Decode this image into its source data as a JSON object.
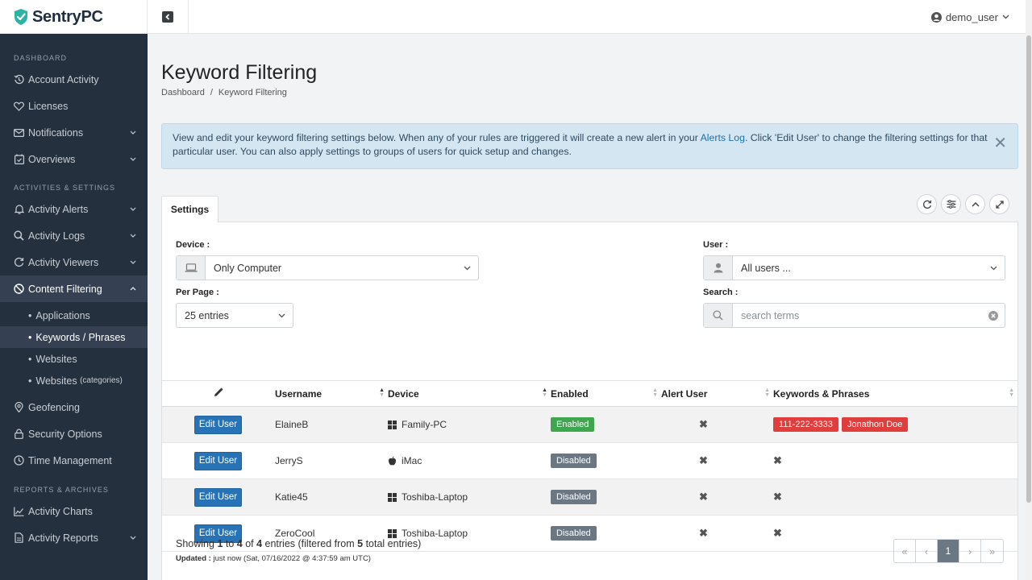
{
  "brand": {
    "name": "SentryPC"
  },
  "header": {
    "user": "demo_user"
  },
  "sidebar": {
    "sections": [
      {
        "title": "DASHBOARD",
        "items": [
          {
            "label": "Account Activity",
            "icon": "history-icon"
          },
          {
            "label": "Licenses",
            "icon": "heart-icon"
          },
          {
            "label": "Notifications",
            "icon": "envelope-icon"
          },
          {
            "label": "Overviews",
            "icon": "calendar-check-icon"
          }
        ]
      },
      {
        "title": "ACTIVITIES & SETTINGS",
        "items": [
          {
            "label": "Activity Alerts",
            "icon": "bell-icon"
          },
          {
            "label": "Activity Logs",
            "icon": "search-icon"
          },
          {
            "label": "Activity Viewers",
            "icon": "refresh-icon"
          },
          {
            "label": "Content Filtering",
            "icon": "ban-icon"
          },
          {
            "label": "Geofencing",
            "icon": "map-pin-icon"
          },
          {
            "label": "Security Options",
            "icon": "lock-icon"
          },
          {
            "label": "Time Management",
            "icon": "clock-icon"
          }
        ]
      },
      {
        "title": "REPORTS & ARCHIVES",
        "items": [
          {
            "label": "Activity Charts",
            "icon": "area-chart-icon"
          },
          {
            "label": "Activity Reports",
            "icon": "file-icon"
          }
        ]
      }
    ],
    "content_filtering_sub": [
      "Applications",
      "Keywords / Phrases",
      "Websites",
      "Websites",
      "(categories)"
    ]
  },
  "page": {
    "title": "Keyword Filtering",
    "breadcrumb": [
      "Dashboard",
      "/",
      "Keyword Filtering"
    ]
  },
  "alert": {
    "text_before": "View and edit your keyword filtering settings below.  When any of your rules are triggered it will create a new alert in your ",
    "link": "Alerts Log",
    "text_after": ".  Click 'Edit User' to change the filtering settings for that particular user.  You can also apply settings to groups of users for quick setup and changes.",
    "close": "✕"
  },
  "tab": {
    "label": "Settings"
  },
  "filters": {
    "device_label": "Device :",
    "device_value": "Only Computer",
    "perpage_label": "Per Page :",
    "perpage_value": "25 entries",
    "user_label": "User :",
    "user_value": "All users ...",
    "search_label": "Search :",
    "search_placeholder": "search terms"
  },
  "table": {
    "headers": [
      "Username",
      "Device",
      "Enabled",
      "Alert User",
      "Keywords & Phrases"
    ],
    "edit_label": "Edit User",
    "rows": [
      {
        "username": "ElaineB",
        "os": "windows",
        "device": "Family-PC",
        "status": "Enabled",
        "alert": "✖",
        "keywords": [
          "111-222-3333",
          "Jonathon Doe"
        ]
      },
      {
        "username": "JerryS",
        "os": "apple",
        "device": "iMac",
        "status": "Disabled",
        "alert": "✖",
        "keywords_none": "✖"
      },
      {
        "username": "Katie45",
        "os": "windows",
        "device": "Toshiba-Laptop",
        "status": "Disabled",
        "alert": "✖",
        "keywords_none": "✖"
      },
      {
        "username": "ZeroCool",
        "os": "windows",
        "device": "Toshiba-Laptop",
        "status": "Disabled",
        "alert": "✖",
        "keywords_none": "✖"
      }
    ]
  },
  "footer": {
    "showing": [
      "Showing ",
      "1",
      " to ",
      "4",
      " of ",
      "4",
      " entries (filtered from ",
      "5",
      " total entries)"
    ],
    "updated_label": "Updated :",
    "updated_value": " just now (Sat, 07/16/2022 @ 4:37:59 am UTC)"
  },
  "pagination": {
    "first": "«",
    "prev": "‹",
    "current": "1",
    "next": "›",
    "last": "»"
  },
  "colors": {
    "sidebar": "#25303e",
    "primary": "#2873b6",
    "enabled": "#3fa650",
    "disabled": "#6b7884",
    "keyword": "#e03d3d",
    "logo_shield": "#2bb3a3"
  }
}
